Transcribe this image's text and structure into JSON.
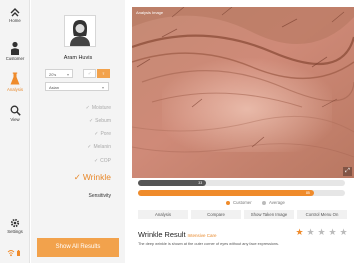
{
  "nav": {
    "items": [
      {
        "label": "Home",
        "icon": "arrows-icon"
      },
      {
        "label": "Customer",
        "icon": "person-icon"
      },
      {
        "label": "Analysis",
        "icon": "flask-icon"
      },
      {
        "label": "View",
        "icon": "magnifier-icon"
      }
    ],
    "settings_label": "Settings"
  },
  "profile": {
    "name": "Aram Huvis",
    "age": "20's",
    "gender_male": "♂",
    "gender_female": "♀",
    "region": "Asian"
  },
  "metrics": {
    "moisture": "Moisture",
    "sebum": "Sebum",
    "pore": "Pore",
    "melanin": "Melanin",
    "cop": "COP",
    "wrinkle": "Wrinkle",
    "sensitivity": "Sensitivity",
    "check": "✓"
  },
  "show_all_label": "Show All Results",
  "image": {
    "label": "Analysis Image"
  },
  "scale": {
    "customer_value": "33",
    "customer_fraction": 0.33,
    "average_value": "85",
    "average_fraction": 0.85,
    "legend_customer": "Customer",
    "legend_average": "Average",
    "colors": {
      "customer": "#555555",
      "average": "#ef8b2b"
    }
  },
  "tabs": {
    "analysis": "Analysis",
    "compare": "Compare",
    "show_taken": "Show Taken Image",
    "control_menu": "Control Menu On"
  },
  "result": {
    "title": "Wrinkle Result",
    "subtitle": "Intensive Care",
    "rating": 1,
    "rating_max": 5,
    "description": "The deep wrinkle is shown at the outer corner of eyes without any face expressions."
  },
  "accent_color": "#ef8b2b"
}
